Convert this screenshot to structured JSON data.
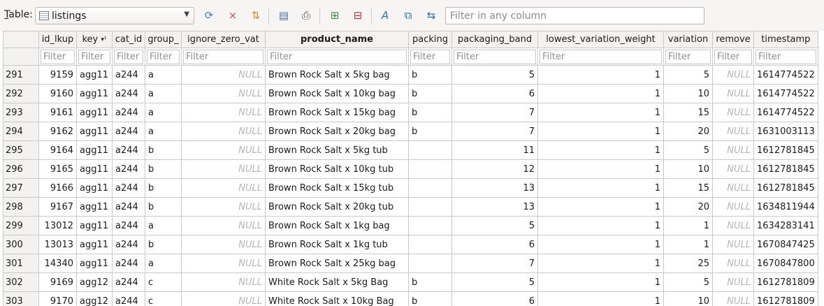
{
  "toolbar": {
    "table_label": "Table:",
    "table_label_key": "T",
    "table_label_rest": "able:",
    "table_select_value": "listings",
    "filter_placeholder": "Filter in any column",
    "icons": [
      "refresh-icon",
      "clear-filters-icon",
      "sort-icon",
      "save-icon",
      "print-icon",
      "insert-record-icon",
      "delete-record-icon",
      "font-icon",
      "copy-icon",
      "decode-icon"
    ]
  },
  "grid": {
    "sort_marker": "▾¹",
    "columns": [
      "id_lkup",
      "key",
      "cat_id",
      "group_",
      "ignore_zero_vat",
      "product_name",
      "packing",
      "packaging_band",
      "lowest_variation_weight",
      "variation",
      "remove",
      "timestamp"
    ],
    "filter_placeholder": "Filter",
    "null_text": "NULL",
    "rows": [
      {
        "row": "291",
        "id_lkup": "9159",
        "key": "agg11",
        "cat_id": "a244",
        "group_": "a",
        "ignore_zero_vat": "NULL",
        "product_name": "Brown Rock Salt x 5kg bag",
        "packing": "b",
        "packaging_band": "5",
        "lowest_variation_weight": "1",
        "variation": "5",
        "remove": "NULL",
        "timestamp": "1614774522"
      },
      {
        "row": "292",
        "id_lkup": "9160",
        "key": "agg11",
        "cat_id": "a244",
        "group_": "a",
        "ignore_zero_vat": "NULL",
        "product_name": "Brown Rock Salt x 10kg bag",
        "packing": "b",
        "packaging_band": "6",
        "lowest_variation_weight": "1",
        "variation": "10",
        "remove": "NULL",
        "timestamp": "1614774522"
      },
      {
        "row": "293",
        "id_lkup": "9161",
        "key": "agg11",
        "cat_id": "a244",
        "group_": "a",
        "ignore_zero_vat": "NULL",
        "product_name": "Brown Rock Salt x 15kg bag",
        "packing": "b",
        "packaging_band": "7",
        "lowest_variation_weight": "1",
        "variation": "15",
        "remove": "NULL",
        "timestamp": "1614774522"
      },
      {
        "row": "294",
        "id_lkup": "9162",
        "key": "agg11",
        "cat_id": "a244",
        "group_": "a",
        "ignore_zero_vat": "NULL",
        "product_name": "Brown Rock Salt x 20kg bag",
        "packing": "b",
        "packaging_band": "7",
        "lowest_variation_weight": "1",
        "variation": "20",
        "remove": "NULL",
        "timestamp": "1631003113"
      },
      {
        "row": "295",
        "id_lkup": "9164",
        "key": "agg11",
        "cat_id": "a244",
        "group_": "b",
        "ignore_zero_vat": "NULL",
        "product_name": "Brown Rock Salt x 5kg tub",
        "packing": "",
        "packaging_band": "11",
        "lowest_variation_weight": "1",
        "variation": "5",
        "remove": "NULL",
        "timestamp": "1612781845"
      },
      {
        "row": "296",
        "id_lkup": "9165",
        "key": "agg11",
        "cat_id": "a244",
        "group_": "b",
        "ignore_zero_vat": "NULL",
        "product_name": "Brown Rock Salt x 10kg tub",
        "packing": "",
        "packaging_band": "12",
        "lowest_variation_weight": "1",
        "variation": "10",
        "remove": "NULL",
        "timestamp": "1612781845"
      },
      {
        "row": "297",
        "id_lkup": "9166",
        "key": "agg11",
        "cat_id": "a244",
        "group_": "b",
        "ignore_zero_vat": "NULL",
        "product_name": "Brown Rock Salt x 15kg tub",
        "packing": "",
        "packaging_band": "13",
        "lowest_variation_weight": "1",
        "variation": "15",
        "remove": "NULL",
        "timestamp": "1612781845"
      },
      {
        "row": "298",
        "id_lkup": "9167",
        "key": "agg11",
        "cat_id": "a244",
        "group_": "b",
        "ignore_zero_vat": "NULL",
        "product_name": "Brown Rock Salt x 20kg tub",
        "packing": "",
        "packaging_band": "13",
        "lowest_variation_weight": "1",
        "variation": "20",
        "remove": "NULL",
        "timestamp": "1634811944"
      },
      {
        "row": "299",
        "id_lkup": "13012",
        "key": "agg11",
        "cat_id": "a244",
        "group_": "a",
        "ignore_zero_vat": "NULL",
        "product_name": "Brown Rock Salt x 1kg bag",
        "packing": "",
        "packaging_band": "5",
        "lowest_variation_weight": "1",
        "variation": "1",
        "remove": "NULL",
        "timestamp": "1634283141"
      },
      {
        "row": "300",
        "id_lkup": "13013",
        "key": "agg11",
        "cat_id": "a244",
        "group_": "b",
        "ignore_zero_vat": "NULL",
        "product_name": "Brown Rock Salt x 1kg tub",
        "packing": "",
        "packaging_band": "6",
        "lowest_variation_weight": "1",
        "variation": "1",
        "remove": "NULL",
        "timestamp": "1670847425"
      },
      {
        "row": "301",
        "id_lkup": "14340",
        "key": "agg11",
        "cat_id": "a244",
        "group_": "a",
        "ignore_zero_vat": "NULL",
        "product_name": "Brown Rock Salt x 25kg bag",
        "packing": "",
        "packaging_band": "7",
        "lowest_variation_weight": "1",
        "variation": "25",
        "remove": "NULL",
        "timestamp": "1670847800"
      },
      {
        "row": "302",
        "id_lkup": "9169",
        "key": "agg12",
        "cat_id": "a244",
        "group_": "c",
        "ignore_zero_vat": "NULL",
        "product_name": "White Rock Salt x 5kg Bag",
        "packing": "b",
        "packaging_band": "5",
        "lowest_variation_weight": "1",
        "variation": "5",
        "remove": "NULL",
        "timestamp": "1612781809"
      },
      {
        "row": "303",
        "id_lkup": "9170",
        "key": "agg12",
        "cat_id": "a244",
        "group_": "c",
        "ignore_zero_vat": "NULL",
        "product_name": "White Rock Salt x 10kg Bag",
        "packing": "b",
        "packaging_band": "6",
        "lowest_variation_weight": "1",
        "variation": "10",
        "remove": "NULL",
        "timestamp": "1612781809"
      }
    ]
  }
}
